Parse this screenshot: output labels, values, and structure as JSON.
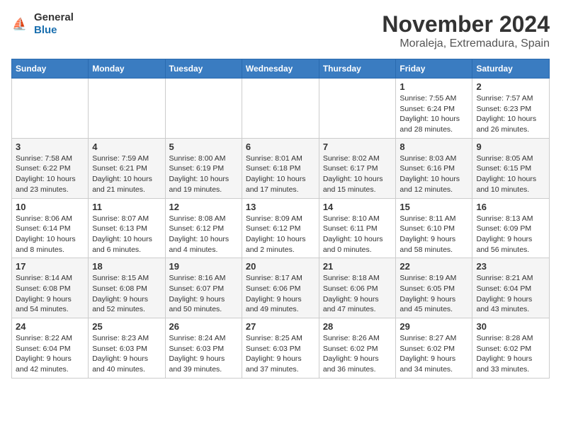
{
  "header": {
    "logo": {
      "general": "General",
      "blue": "Blue",
      "icon_unicode": "⛵"
    },
    "month_title": "November 2024",
    "location": "Moraleja, Extremadura, Spain"
  },
  "calendar": {
    "days_of_week": [
      "Sunday",
      "Monday",
      "Tuesday",
      "Wednesday",
      "Thursday",
      "Friday",
      "Saturday"
    ],
    "weeks": [
      [
        {
          "day": "",
          "info": ""
        },
        {
          "day": "",
          "info": ""
        },
        {
          "day": "",
          "info": ""
        },
        {
          "day": "",
          "info": ""
        },
        {
          "day": "",
          "info": ""
        },
        {
          "day": "1",
          "info": "Sunrise: 7:55 AM\nSunset: 6:24 PM\nDaylight: 10 hours\nand 28 minutes."
        },
        {
          "day": "2",
          "info": "Sunrise: 7:57 AM\nSunset: 6:23 PM\nDaylight: 10 hours\nand 26 minutes."
        }
      ],
      [
        {
          "day": "3",
          "info": "Sunrise: 7:58 AM\nSunset: 6:22 PM\nDaylight: 10 hours\nand 23 minutes."
        },
        {
          "day": "4",
          "info": "Sunrise: 7:59 AM\nSunset: 6:21 PM\nDaylight: 10 hours\nand 21 minutes."
        },
        {
          "day": "5",
          "info": "Sunrise: 8:00 AM\nSunset: 6:19 PM\nDaylight: 10 hours\nand 19 minutes."
        },
        {
          "day": "6",
          "info": "Sunrise: 8:01 AM\nSunset: 6:18 PM\nDaylight: 10 hours\nand 17 minutes."
        },
        {
          "day": "7",
          "info": "Sunrise: 8:02 AM\nSunset: 6:17 PM\nDaylight: 10 hours\nand 15 minutes."
        },
        {
          "day": "8",
          "info": "Sunrise: 8:03 AM\nSunset: 6:16 PM\nDaylight: 10 hours\nand 12 minutes."
        },
        {
          "day": "9",
          "info": "Sunrise: 8:05 AM\nSunset: 6:15 PM\nDaylight: 10 hours\nand 10 minutes."
        }
      ],
      [
        {
          "day": "10",
          "info": "Sunrise: 8:06 AM\nSunset: 6:14 PM\nDaylight: 10 hours\nand 8 minutes."
        },
        {
          "day": "11",
          "info": "Sunrise: 8:07 AM\nSunset: 6:13 PM\nDaylight: 10 hours\nand 6 minutes."
        },
        {
          "day": "12",
          "info": "Sunrise: 8:08 AM\nSunset: 6:12 PM\nDaylight: 10 hours\nand 4 minutes."
        },
        {
          "day": "13",
          "info": "Sunrise: 8:09 AM\nSunset: 6:12 PM\nDaylight: 10 hours\nand 2 minutes."
        },
        {
          "day": "14",
          "info": "Sunrise: 8:10 AM\nSunset: 6:11 PM\nDaylight: 10 hours\nand 0 minutes."
        },
        {
          "day": "15",
          "info": "Sunrise: 8:11 AM\nSunset: 6:10 PM\nDaylight: 9 hours\nand 58 minutes."
        },
        {
          "day": "16",
          "info": "Sunrise: 8:13 AM\nSunset: 6:09 PM\nDaylight: 9 hours\nand 56 minutes."
        }
      ],
      [
        {
          "day": "17",
          "info": "Sunrise: 8:14 AM\nSunset: 6:08 PM\nDaylight: 9 hours\nand 54 minutes."
        },
        {
          "day": "18",
          "info": "Sunrise: 8:15 AM\nSunset: 6:08 PM\nDaylight: 9 hours\nand 52 minutes."
        },
        {
          "day": "19",
          "info": "Sunrise: 8:16 AM\nSunset: 6:07 PM\nDaylight: 9 hours\nand 50 minutes."
        },
        {
          "day": "20",
          "info": "Sunrise: 8:17 AM\nSunset: 6:06 PM\nDaylight: 9 hours\nand 49 minutes."
        },
        {
          "day": "21",
          "info": "Sunrise: 8:18 AM\nSunset: 6:06 PM\nDaylight: 9 hours\nand 47 minutes."
        },
        {
          "day": "22",
          "info": "Sunrise: 8:19 AM\nSunset: 6:05 PM\nDaylight: 9 hours\nand 45 minutes."
        },
        {
          "day": "23",
          "info": "Sunrise: 8:21 AM\nSunset: 6:04 PM\nDaylight: 9 hours\nand 43 minutes."
        }
      ],
      [
        {
          "day": "24",
          "info": "Sunrise: 8:22 AM\nSunset: 6:04 PM\nDaylight: 9 hours\nand 42 minutes."
        },
        {
          "day": "25",
          "info": "Sunrise: 8:23 AM\nSunset: 6:03 PM\nDaylight: 9 hours\nand 40 minutes."
        },
        {
          "day": "26",
          "info": "Sunrise: 8:24 AM\nSunset: 6:03 PM\nDaylight: 9 hours\nand 39 minutes."
        },
        {
          "day": "27",
          "info": "Sunrise: 8:25 AM\nSunset: 6:03 PM\nDaylight: 9 hours\nand 37 minutes."
        },
        {
          "day": "28",
          "info": "Sunrise: 8:26 AM\nSunset: 6:02 PM\nDaylight: 9 hours\nand 36 minutes."
        },
        {
          "day": "29",
          "info": "Sunrise: 8:27 AM\nSunset: 6:02 PM\nDaylight: 9 hours\nand 34 minutes."
        },
        {
          "day": "30",
          "info": "Sunrise: 8:28 AM\nSunset: 6:02 PM\nDaylight: 9 hours\nand 33 minutes."
        }
      ]
    ]
  }
}
